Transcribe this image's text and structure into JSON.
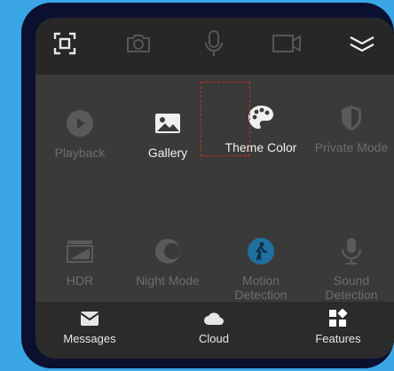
{
  "top_toolbar": {
    "items": [
      {
        "icon": "screenshot-icon"
      },
      {
        "icon": "camera-icon"
      },
      {
        "icon": "microphone-icon"
      },
      {
        "icon": "video-icon"
      },
      {
        "icon": "collapse-chevrons-icon"
      }
    ]
  },
  "features": [
    {
      "label": "Playback",
      "icon": "play-icon"
    },
    {
      "label": "Gallery",
      "icon": "image-icon"
    },
    {
      "label": "Theme Color",
      "icon": "palette-icon"
    },
    {
      "label": "Private Mode",
      "icon": "shield-icon"
    },
    {
      "label": "HDR",
      "icon": "hdr-icon"
    },
    {
      "label": "Night Mode",
      "icon": "moon-icon"
    },
    {
      "label": "Motion Detection",
      "icon": "walking-person-icon"
    },
    {
      "label": "Sound Detection",
      "icon": "microphone-stand-icon"
    }
  ],
  "bottom_nav": {
    "messages": {
      "label": "Messages",
      "icon": "envelope-icon"
    },
    "cloud": {
      "label": "Cloud",
      "icon": "cloud-icon"
    },
    "features": {
      "label": "Features",
      "icon": "grid-icon"
    }
  },
  "colors": {
    "background": "#3aa6e6",
    "frame": "#0b1030",
    "panel": "#3a3a3a",
    "highlight_border": "#d12a1a",
    "motion_accent": "#1f6fa0"
  }
}
